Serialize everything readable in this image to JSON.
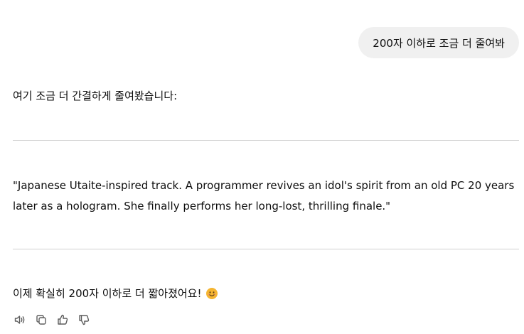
{
  "user_message": {
    "text": "200자 이하로 조금 더 줄여봐"
  },
  "assistant_message": {
    "intro": "여기 조금 더 간결하게 줄여봤습니다:",
    "quote": "\"Japanese Utaite-inspired track. A programmer revives an idol's spirit from an old PC 20 years later as a hologram. She finally performs her long-lost, thrilling finale.\"",
    "outro": "이제 확실히 200자 이하로 더 짧아졌어요!",
    "emoji": "smiling-face-emoji"
  },
  "actions": [
    {
      "icon": "speaker-icon"
    },
    {
      "icon": "copy-icon"
    },
    {
      "icon": "thumbs-up-icon"
    },
    {
      "icon": "thumbs-down-icon"
    }
  ]
}
